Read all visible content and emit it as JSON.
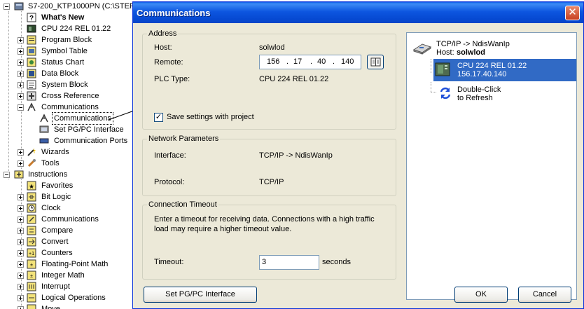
{
  "tree": {
    "project": "S7-200_KTP1000PN (C:\\STEP",
    "items": [
      {
        "label": "What's New",
        "bold": true
      },
      {
        "label": "CPU 224 REL 01.22"
      },
      {
        "label": "Program Block"
      },
      {
        "label": "Symbol Table"
      },
      {
        "label": "Status Chart"
      },
      {
        "label": "Data Block"
      },
      {
        "label": "System Block"
      },
      {
        "label": "Cross Reference"
      },
      {
        "label": "Communications"
      },
      {
        "label": "Communications"
      },
      {
        "label": "Set PG/PC Interface"
      },
      {
        "label": "Communication Ports"
      },
      {
        "label": "Wizards"
      },
      {
        "label": "Tools"
      },
      {
        "label": "Instructions"
      },
      {
        "label": "Favorites"
      },
      {
        "label": "Bit Logic"
      },
      {
        "label": "Clock"
      },
      {
        "label": "Communications"
      },
      {
        "label": "Compare"
      },
      {
        "label": "Convert"
      },
      {
        "label": "Counters"
      },
      {
        "label": "Floating-Point Math"
      },
      {
        "label": "Integer Math"
      },
      {
        "label": "Interrupt"
      },
      {
        "label": "Logical Operations"
      },
      {
        "label": "Move"
      }
    ]
  },
  "dialog": {
    "title": "Communications",
    "close_glyph": "✕",
    "address": {
      "legend": "Address",
      "host_label": "Host:",
      "host_value": "solwlod",
      "remote_label": "Remote:",
      "remote_octets": [
        "156",
        "17",
        "40",
        "140"
      ],
      "plc_type_label": "PLC Type:",
      "plc_type_value": "CPU 224 REL 01.22",
      "save_label": "Save settings with project",
      "save_checked": "✓"
    },
    "network": {
      "legend": "Network Parameters",
      "interface_label": "Interface:",
      "interface_value": "TCP/IP -> NdisWanIp",
      "protocol_label": "Protocol:",
      "protocol_value": "TCP/IP"
    },
    "timeout": {
      "legend": "Connection Timeout",
      "desc_line1": "Enter a timeout for receiving data.  Connections with a high traffic",
      "desc_line2": "load may require a higher timeout value.",
      "timeout_label": "Timeout:",
      "timeout_value": "3",
      "units": "seconds"
    },
    "buttons": {
      "set_pgpc": "Set PG/PC Interface",
      "ok": "OK",
      "cancel": "Cancel"
    },
    "network_view": {
      "interface": "TCP/IP -> NdisWanIp",
      "host_prefix": "Host:",
      "host_name": "solwlod",
      "cpu_line1": "CPU 224 REL 01.22",
      "cpu_line2": "156.17.40.140",
      "refresh_line1": "Double-Click",
      "refresh_line2": "to Refresh"
    }
  },
  "colors": {
    "title_bar": "#0a5ae8",
    "selection": "#316ac5",
    "dialog_bg": "#ece9d8"
  }
}
